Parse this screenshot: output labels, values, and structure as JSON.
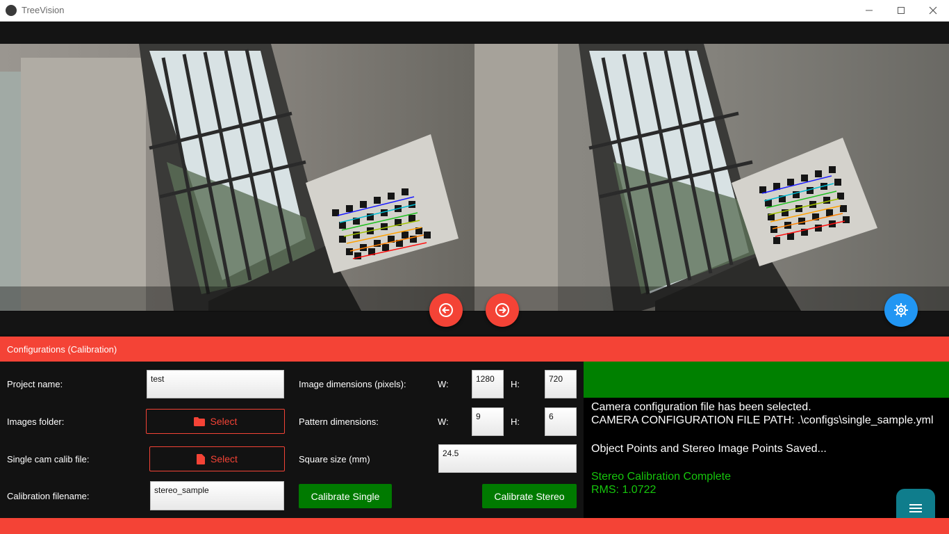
{
  "window": {
    "title": "TreeVision"
  },
  "config": {
    "header": "Configurations (Calibration)"
  },
  "form": {
    "project_name_label": "Project name:",
    "project_name_value": "test",
    "images_folder_label": "Images folder:",
    "select_label": "Select",
    "single_cam_label": "Single cam calib file:",
    "calib_filename_label": "Calibration filename:",
    "calib_filename_value": "stereo_sample",
    "image_dims_label": "Image dimensions (pixels):",
    "pattern_dims_label": "Pattern dimensions:",
    "w_label": "W:",
    "h_label": "H:",
    "image_w": "1280",
    "image_h": "720",
    "pattern_w": "9",
    "pattern_h": "6",
    "square_size_label": "Square size (mm)",
    "square_size_value": "24.5",
    "calibrate_single": "Calibrate Single",
    "calibrate_stereo": "Calibrate Stereo"
  },
  "log": {
    "lines": [
      "Camera configuration file has been selected.",
      "CAMERA CONFIGURATION FILE PATH: .\\configs\\single_sample.yml",
      "Object Points and Stereo Image Points Saved...",
      "Stereo Calibration Complete",
      "RMS: 1.0722"
    ]
  },
  "colors": {
    "accent_red": "#f44336",
    "success_green": "#008000",
    "button_green": "#007a00",
    "settings_blue": "#2196f3",
    "fab_teal": "#0f7d8c"
  },
  "icons": [
    "app-icon",
    "minimize-icon",
    "maximize-icon",
    "close-icon",
    "arrow-left-circle-icon",
    "arrow-right-circle-icon",
    "settings-gear-icon",
    "folder-icon",
    "file-icon",
    "menu-icon"
  ]
}
